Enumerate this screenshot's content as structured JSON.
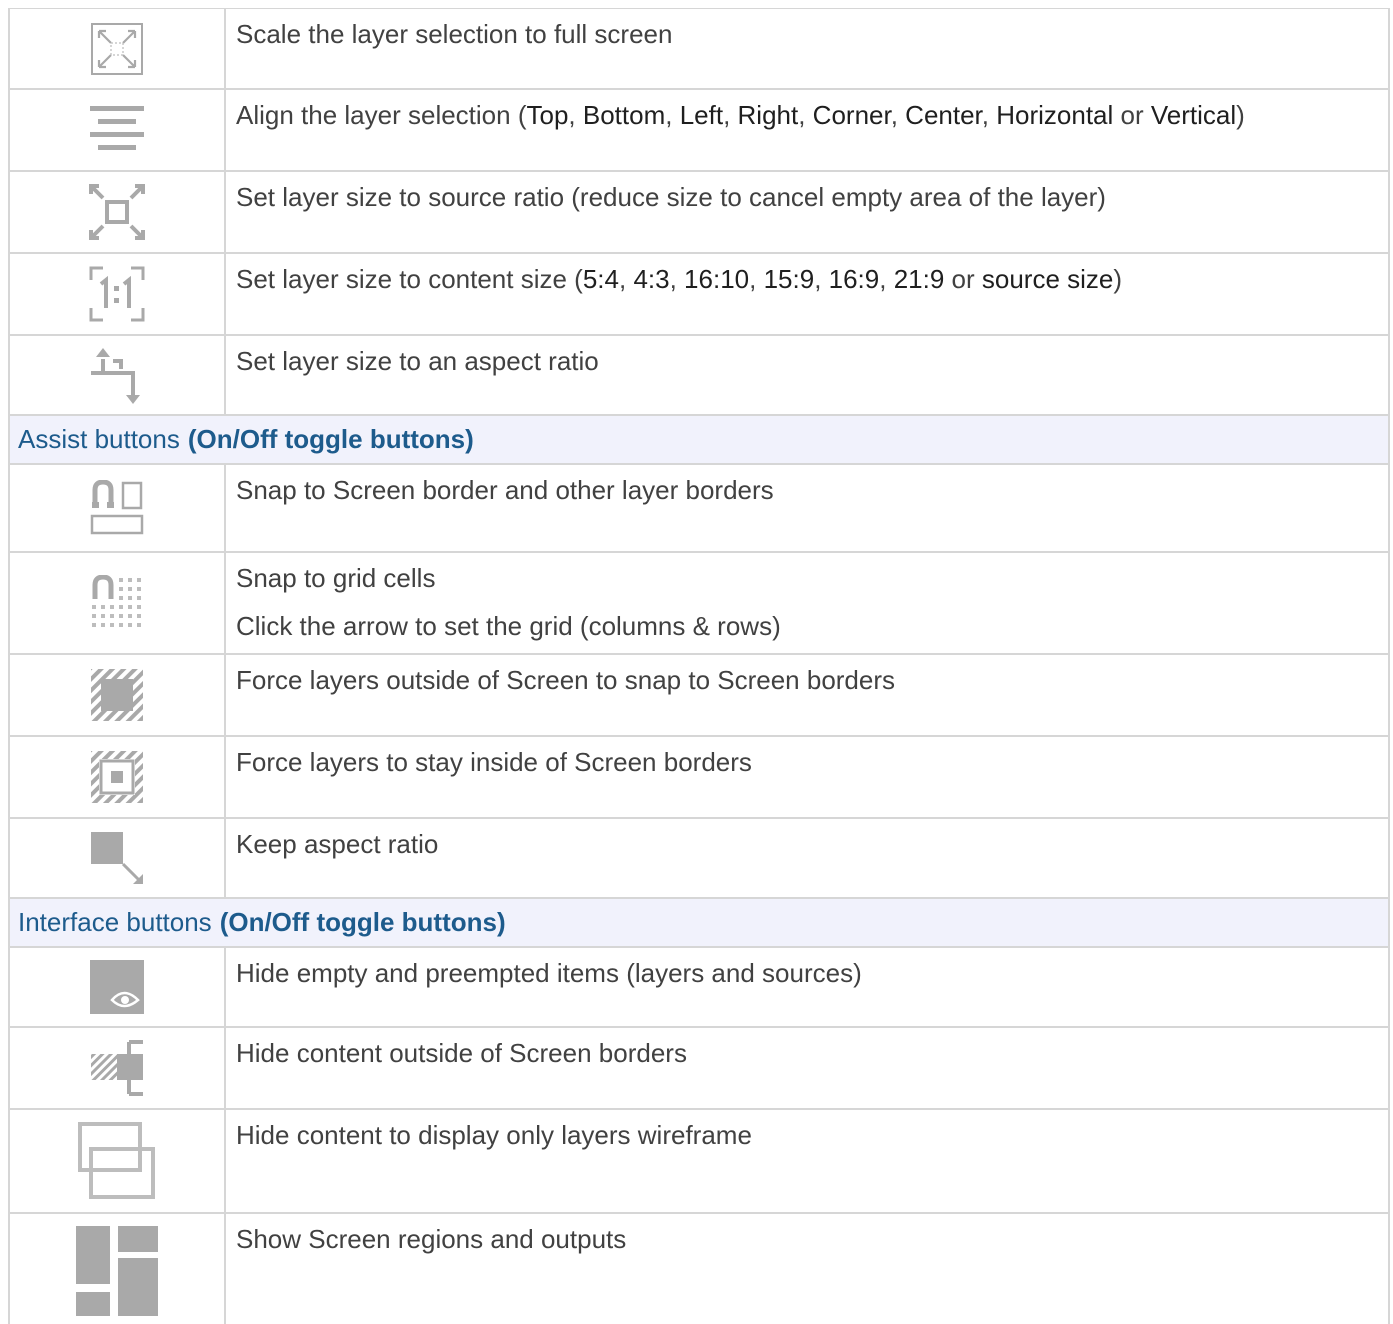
{
  "rows_top": [
    {
      "icon": "fullscreen-icon",
      "text": [
        "Scale the layer selection to full screen"
      ]
    },
    {
      "icon": "align-icon",
      "parts": [
        {
          "t": "Align the layer selection (",
          "h": false
        },
        {
          "t": "Top",
          "h": true
        },
        {
          "t": ", ",
          "h": false
        },
        {
          "t": "Bottom",
          "h": true
        },
        {
          "t": ", ",
          "h": false
        },
        {
          "t": "Left",
          "h": true
        },
        {
          "t": ", ",
          "h": false
        },
        {
          "t": "Right",
          "h": true
        },
        {
          "t": ", ",
          "h": false
        },
        {
          "t": "Corner",
          "h": true
        },
        {
          "t": ", ",
          "h": false
        },
        {
          "t": "Center",
          "h": true
        },
        {
          "t": ", ",
          "h": false
        },
        {
          "t": "Horizontal",
          "h": true
        },
        {
          "t": " or ",
          "h": false
        },
        {
          "t": "Vertical",
          "h": true
        },
        {
          "t": ")",
          "h": false
        }
      ]
    },
    {
      "icon": "fit-to-source-ratio-icon",
      "text": [
        "Set layer size to source ratio (reduce size to cancel empty area of the layer)"
      ]
    },
    {
      "icon": "content-size-icon",
      "parts": [
        {
          "t": "Set layer size to content size (",
          "h": false
        },
        {
          "t": "5:4",
          "h": true
        },
        {
          "t": ", ",
          "h": false
        },
        {
          "t": "4:3",
          "h": true
        },
        {
          "t": ", ",
          "h": false
        },
        {
          "t": "16:10",
          "h": true
        },
        {
          "t": ", ",
          "h": false
        },
        {
          "t": "15:9",
          "h": true
        },
        {
          "t": ", ",
          "h": false
        },
        {
          "t": "16:9",
          "h": true
        },
        {
          "t": ", ",
          "h": false
        },
        {
          "t": "21:9",
          "h": true
        },
        {
          "t": " or ",
          "h": false
        },
        {
          "t": "source size",
          "h": true
        },
        {
          "t": ")",
          "h": false
        }
      ]
    },
    {
      "icon": "crop-icon",
      "text": [
        "Set layer size to an aspect ratio"
      ]
    }
  ],
  "assist": {
    "title": "Assist buttons",
    "subtitle": "(On/Off toggle buttons)",
    "rows": [
      {
        "icon": "snap-borders-icon",
        "text": [
          "Snap to Screen border and other layer borders"
        ]
      },
      {
        "icon": "snap-grid-icon",
        "text": [
          "Snap to grid cells",
          "Click the arrow to set the grid (columns & rows)"
        ]
      },
      {
        "icon": "force-snap-icon",
        "text": [
          "Force layers outside of Screen to snap to Screen borders"
        ]
      },
      {
        "icon": "stay-inside-icon",
        "text": [
          "Force layers to stay inside of Screen borders"
        ]
      },
      {
        "icon": "keep-aspect-icon",
        "text": [
          "Keep aspect ratio"
        ]
      }
    ]
  },
  "interface": {
    "title": "Interface buttons",
    "subtitle": "(On/Off toggle buttons)",
    "rows": [
      {
        "icon": "hide-empty-eye-icon",
        "text": [
          "Hide empty and preempted items (layers and sources)"
        ]
      },
      {
        "icon": "hide-outside-icon",
        "text": [
          "Hide content outside of Screen borders"
        ]
      },
      {
        "icon": "wireframe-icon",
        "text": [
          "Hide content to display only layers wireframe"
        ]
      },
      {
        "icon": "regions-icon",
        "text": [
          "Show Screen regions and outputs"
        ]
      }
    ]
  }
}
